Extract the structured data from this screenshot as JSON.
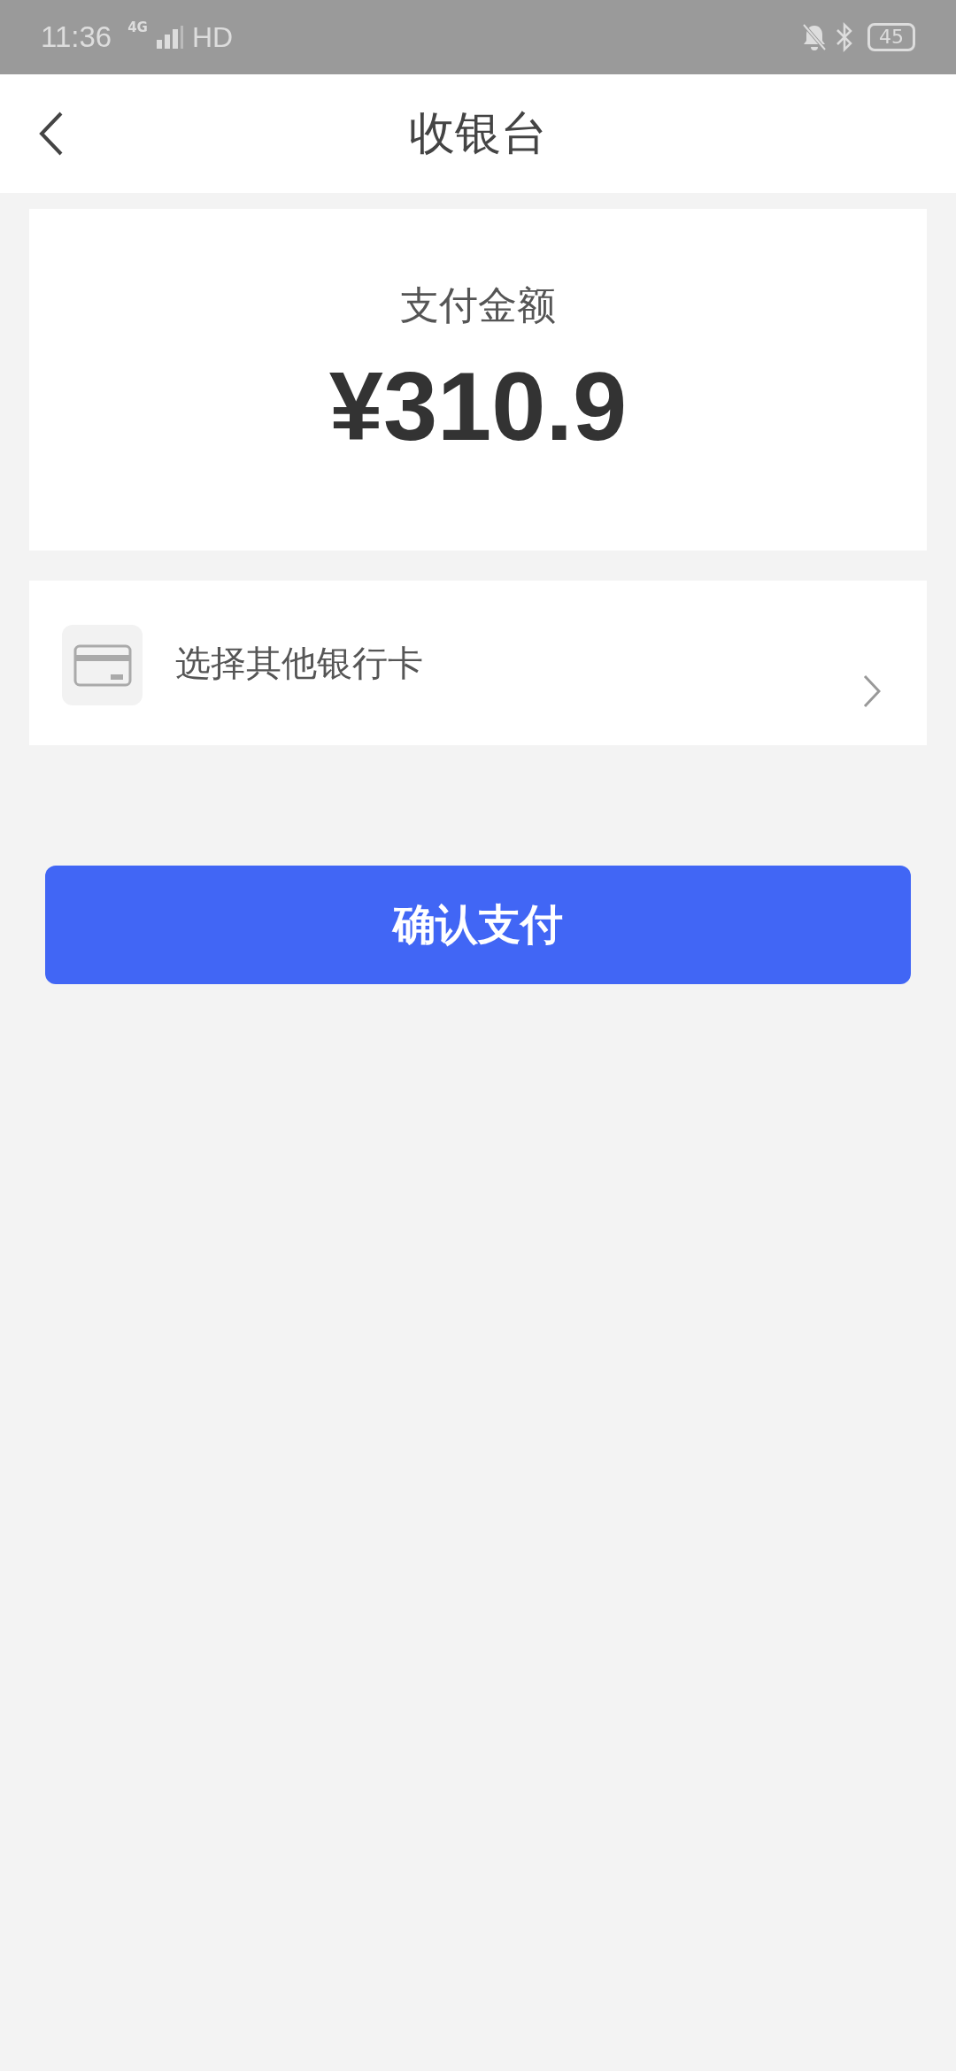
{
  "status_bar": {
    "time": "11:36",
    "network": "4G",
    "hd": "HD",
    "battery": "45"
  },
  "header": {
    "title": "收银台"
  },
  "amount_card": {
    "label": "支付金额",
    "amount": "¥310.9"
  },
  "payment_option": {
    "label": "选择其他银行卡"
  },
  "confirm_button": {
    "label": "确认支付"
  }
}
